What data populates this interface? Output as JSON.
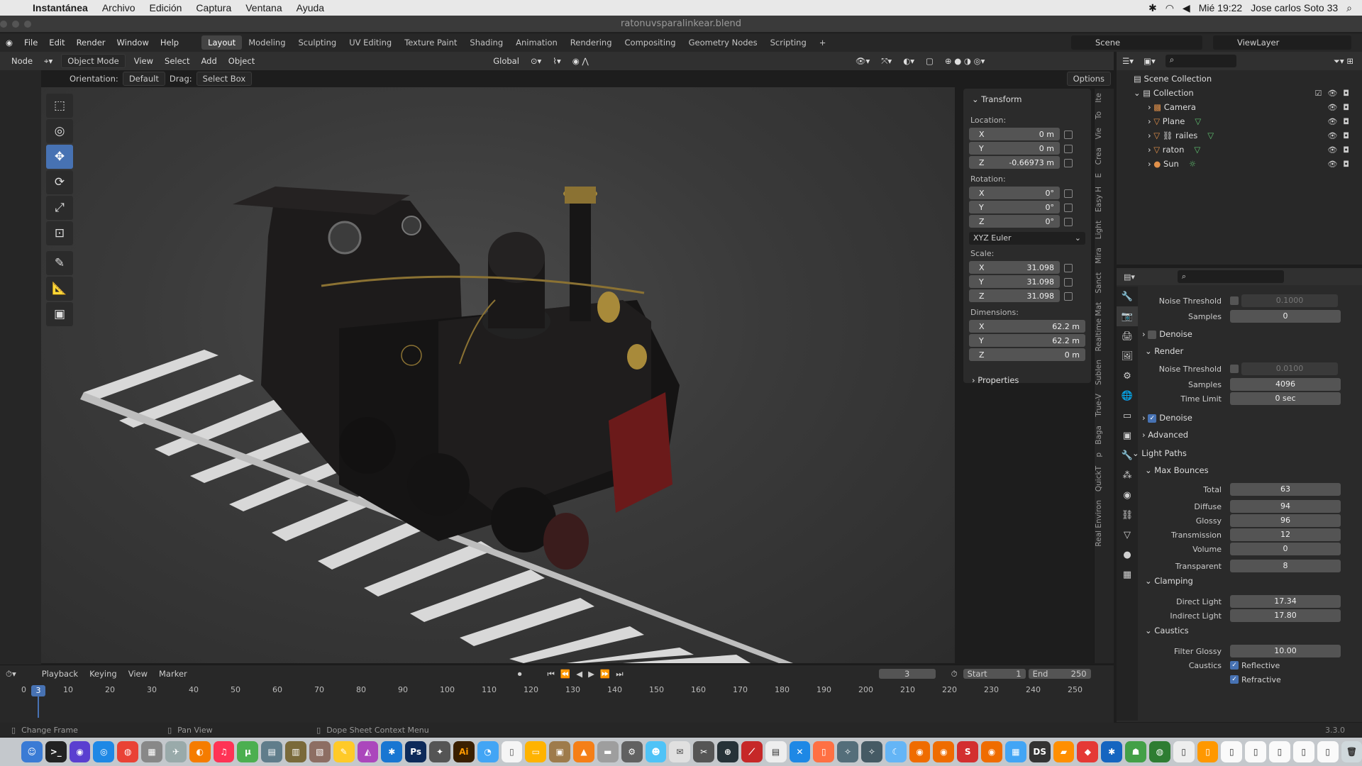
{
  "mac_menu": {
    "app_name": "Instantánea",
    "items": [
      "Archivo",
      "Edición",
      "Captura",
      "Ventana",
      "Ayuda"
    ],
    "clock": "Mié 19:22",
    "user": "Jose carlos Soto 33"
  },
  "window": {
    "title": "ratonuvsparalinkear.blend"
  },
  "blender_menu": [
    "File",
    "Edit",
    "Render",
    "Window",
    "Help"
  ],
  "workspaces": [
    {
      "label": "Layout",
      "active": true
    },
    {
      "label": "Modeling"
    },
    {
      "label": "Sculpting"
    },
    {
      "label": "UV Editing"
    },
    {
      "label": "Texture Paint"
    },
    {
      "label": "Shading"
    },
    {
      "label": "Animation"
    },
    {
      "label": "Rendering"
    },
    {
      "label": "Compositing"
    },
    {
      "label": "Geometry Nodes"
    },
    {
      "label": "Scripting"
    }
  ],
  "scene_name": "Scene",
  "view_layer": "ViewLayer",
  "viewport_header": {
    "node_label": "Node",
    "mode": "Object Mode",
    "menus": [
      "View",
      "Select",
      "Add",
      "Object"
    ],
    "transform_orientation": "Global",
    "orientation_label": "Orientation:",
    "orientation_value": "Default",
    "drag_label": "Drag:",
    "drag_value": "Select Box",
    "options_label": "Options"
  },
  "tools": [
    {
      "name": "select-box-tool",
      "glyph": "⬚",
      "active": false
    },
    {
      "name": "cursor-tool",
      "glyph": "◎",
      "active": false
    },
    {
      "name": "move-tool",
      "glyph": "✥",
      "active": true
    },
    {
      "name": "rotate-tool",
      "glyph": "⟳",
      "active": false
    },
    {
      "name": "scale-tool",
      "glyph": "⤢",
      "active": false
    },
    {
      "name": "transform-tool",
      "glyph": "⊡",
      "active": false
    },
    {
      "name": "annotate-tool",
      "glyph": "✎",
      "active": false
    },
    {
      "name": "measure-tool",
      "glyph": "📐",
      "active": false
    },
    {
      "name": "add-cube-tool",
      "glyph": "▣",
      "active": false
    }
  ],
  "transform_panel": {
    "title": "Transform",
    "location_label": "Location:",
    "location": [
      {
        "axis": "X",
        "value": "0 m"
      },
      {
        "axis": "Y",
        "value": "0 m"
      },
      {
        "axis": "Z",
        "value": "-0.66973 m"
      }
    ],
    "rotation_label": "Rotation:",
    "rotation": [
      {
        "axis": "X",
        "value": "0°"
      },
      {
        "axis": "Y",
        "value": "0°"
      },
      {
        "axis": "Z",
        "value": "0°"
      }
    ],
    "rotation_mode": "XYZ Euler",
    "scale_label": "Scale:",
    "scale": [
      {
        "axis": "X",
        "value": "31.098"
      },
      {
        "axis": "Y",
        "value": "31.098"
      },
      {
        "axis": "Z",
        "value": "31.098"
      }
    ],
    "dimensions_label": "Dimensions:",
    "dimensions": [
      {
        "axis": "X",
        "value": "62.2 m"
      },
      {
        "axis": "Y",
        "value": "62.2 m"
      },
      {
        "axis": "Z",
        "value": "0 m"
      }
    ],
    "properties_label": "Properties"
  },
  "side_tabs": [
    "Ite",
    "To",
    "Vie",
    "Crea",
    "E",
    "Easy H",
    "Light",
    "Mira",
    "Sanct",
    "Realtime Mat",
    "Sublen",
    "True-V",
    "Baga",
    "p",
    "QuickT",
    "Real Environ"
  ],
  "outliner": {
    "root": "Scene Collection",
    "collection": "Collection",
    "objects": [
      "Camera",
      "Plane",
      "railes",
      "raton",
      "Sun"
    ]
  },
  "render_props": {
    "noise_threshold_1": "0.1000",
    "samples_1": "0",
    "denoise_label": "Denoise",
    "render_label": "Render",
    "noise_threshold_label": "Noise Threshold",
    "noise_threshold_2": "0.0100",
    "samples_label": "Samples",
    "samples_2": "4096",
    "time_limit_label": "Time Limit",
    "time_limit": "0 sec",
    "advanced_label": "Advanced",
    "light_paths_label": "Light Paths",
    "max_bounces_label": "Max Bounces",
    "bounces": [
      {
        "label": "Total",
        "value": "63"
      },
      {
        "label": "Diffuse",
        "value": "94"
      },
      {
        "label": "Glossy",
        "value": "96"
      },
      {
        "label": "Transmission",
        "value": "12"
      },
      {
        "label": "Volume",
        "value": "0"
      },
      {
        "label": "Transparent",
        "value": "8"
      }
    ],
    "clamping_label": "Clamping",
    "direct_light_label": "Direct Light",
    "direct_light": "17.34",
    "indirect_light_label": "Indirect Light",
    "indirect_light": "17.80",
    "caustics_label": "Caustics",
    "filter_glossy_label": "Filter Glossy",
    "filter_glossy": "10.00",
    "caustics_row_label": "Caustics",
    "reflective_label": "Reflective",
    "refractive_label": "Refractive"
  },
  "timeline": {
    "menus": [
      "Playback",
      "Keying",
      "View",
      "Marker"
    ],
    "current_frame": "3",
    "start_label": "Start",
    "start": "1",
    "end_label": "End",
    "end": "250",
    "ruler": [
      "0",
      "10",
      "20",
      "30",
      "40",
      "50",
      "60",
      "70",
      "80",
      "90",
      "100",
      "110",
      "120",
      "130",
      "140",
      "150",
      "160",
      "170",
      "180",
      "190",
      "200",
      "210",
      "220",
      "230",
      "240",
      "250"
    ]
  },
  "status": {
    "left": "Change Frame",
    "mid": "Pan View",
    "right": "Dope Sheet Context Menu",
    "version": "3.3.0"
  },
  "colors": {
    "accent": "#4772b3",
    "background": "#1d1d1d",
    "panel": "#2b2b2b",
    "train_body": "#1a1818",
    "brass": "#a88a3a",
    "rail": "#d8d8d8"
  }
}
